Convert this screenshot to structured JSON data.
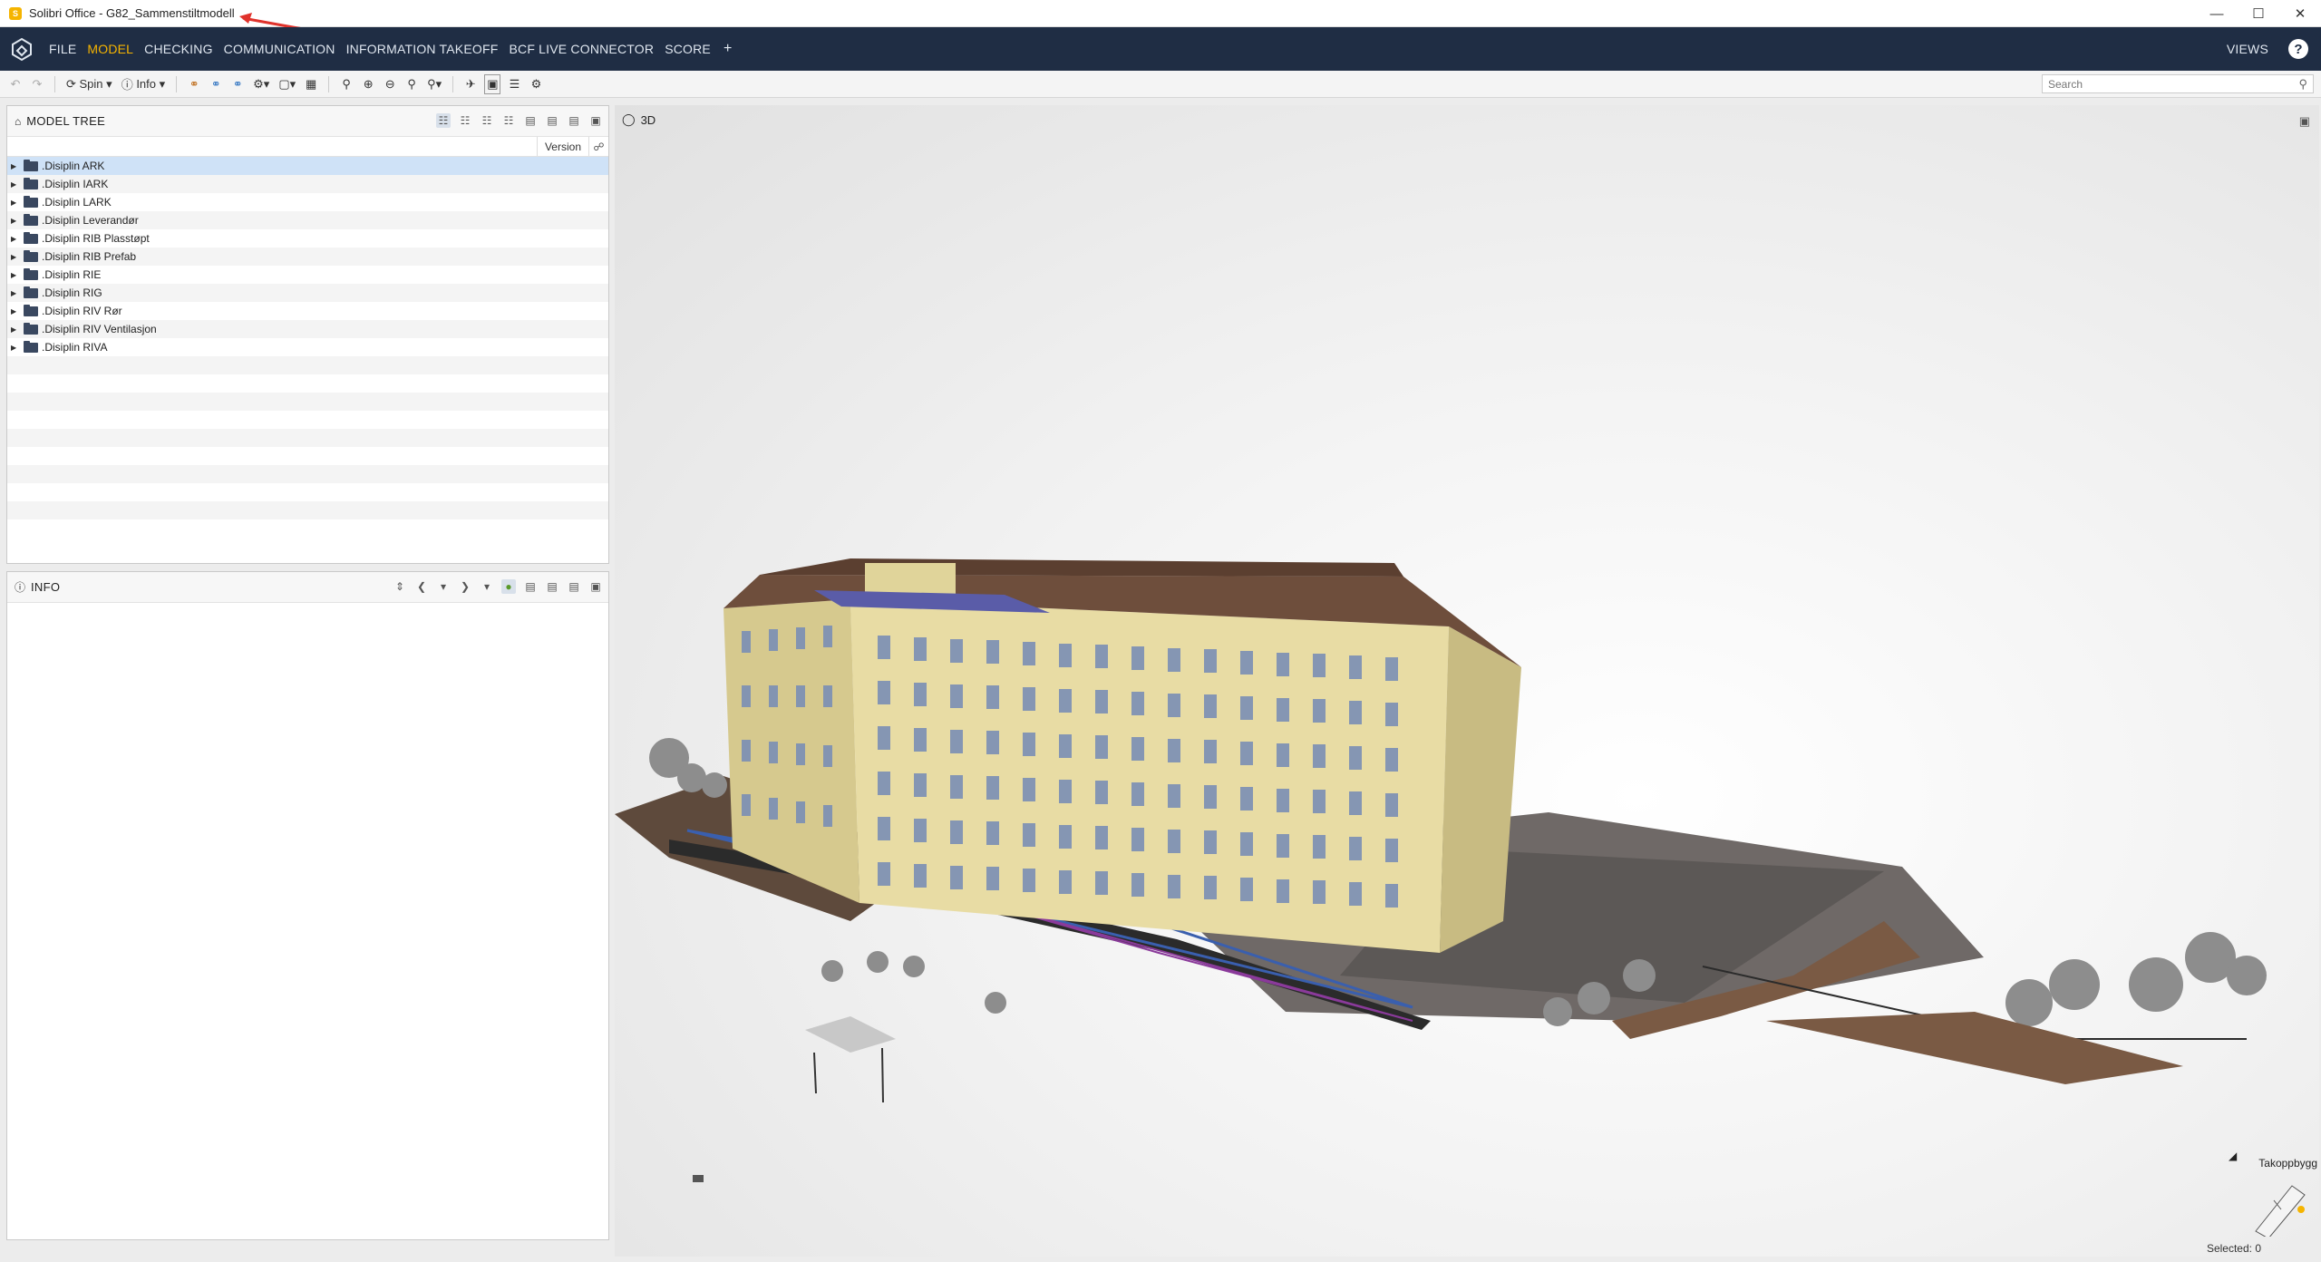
{
  "window": {
    "title": "Solibri Office - G82_Sammenstiltmodell",
    "controls": [
      "minimize-icon",
      "maximize-icon",
      "close-icon"
    ]
  },
  "menubar": {
    "items": [
      {
        "label": "FILE",
        "active": false
      },
      {
        "label": "MODEL",
        "active": true
      },
      {
        "label": "CHECKING",
        "active": false
      },
      {
        "label": "COMMUNICATION",
        "active": false
      },
      {
        "label": "INFORMATION TAKEOFF",
        "active": false
      },
      {
        "label": "BCF LIVE CONNECTOR",
        "active": false
      },
      {
        "label": "SCORE",
        "active": false
      }
    ],
    "add_label": "+",
    "views_label": "VIEWS",
    "help_label": "?"
  },
  "toolbar": {
    "spin_label": "Spin",
    "info_label": "Info",
    "search_placeholder": "Search"
  },
  "model_tree": {
    "title": "MODEL TREE",
    "column_version": "Version",
    "items": [
      ".Disiplin ARK",
      ".Disiplin IARK",
      ".Disiplin LARK",
      ".Disiplin Leverandør",
      ".Disiplin RIB Plasstøpt",
      ".Disiplin RIB Prefab",
      ".Disiplin RIE",
      ".Disiplin RIG",
      ".Disiplin RIV Rør",
      ".Disiplin RIV Ventilasjon",
      ".Disiplin RIVA"
    ],
    "selected_index": 0
  },
  "info_panel": {
    "title": "INFO"
  },
  "view3d": {
    "label": "3D",
    "nav_label": "Takoppbygg",
    "selected_text": "Selected: 0"
  },
  "colors": {
    "menubar_bg": "#1f2d44",
    "accent": "#f5b400",
    "annotation_arrow": "#e0322b",
    "facade": "#e8dca4"
  }
}
